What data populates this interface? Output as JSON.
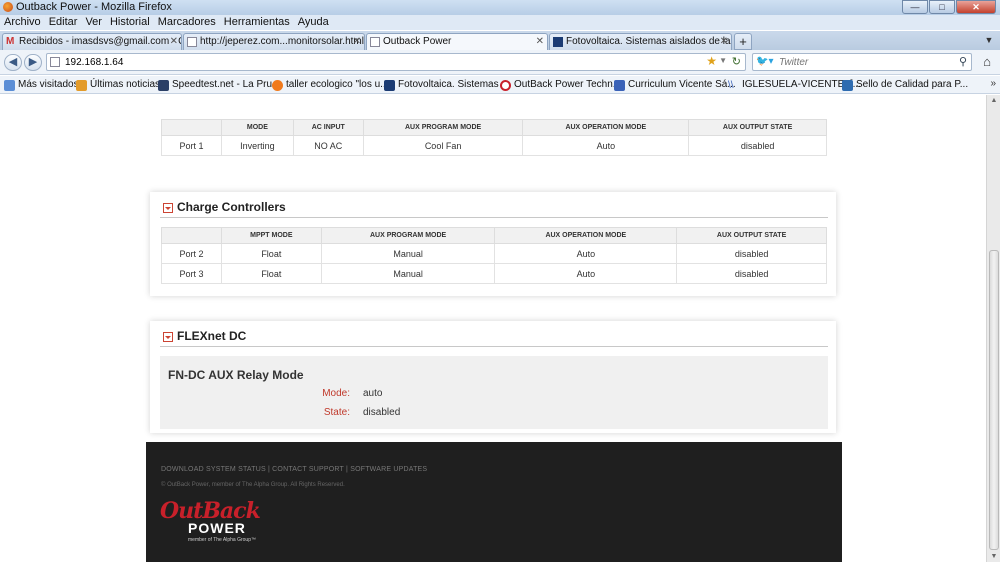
{
  "window": {
    "title": "Outback Power - Mozilla Firefox",
    "minimize": "—",
    "maximize": "□",
    "close": "✕"
  },
  "menu": [
    "Archivo",
    "Editar",
    "Ver",
    "Historial",
    "Marcadores",
    "Herramientas",
    "Ayuda"
  ],
  "tabs": [
    {
      "label": "Recibidos - imasdsvs@gmail.com - G...",
      "icon": "gmail-icon"
    },
    {
      "label": "http://jeperez.com...monitorsolar.html",
      "icon": "page-icon"
    },
    {
      "label": "Outback Power",
      "icon": "page-icon",
      "active": true
    },
    {
      "label": "Fotovoltaica. Sistemas aislados de la r...",
      "icon": "fotovoltaica-icon"
    }
  ],
  "nav": {
    "url": "192.168.1.64",
    "search_placeholder": "Twitter"
  },
  "bookmarks": [
    "Más visitados",
    "Últimas noticias",
    "Speedtest.net - La Pru...",
    "taller ecologico \"los u...",
    "Fotovoltaica. Sistemas ...",
    "OutBack Power Techn...",
    "Curriculum Vicente Sá...",
    "IGLESUELA-VICENTE: [...",
    "Sello de Calidad para P..."
  ],
  "inverters": {
    "headers": [
      "",
      "MODE",
      "AC INPUT",
      "AUX PROGRAM MODE",
      "AUX OPERATION MODE",
      "AUX OUTPUT STATE"
    ],
    "rows": [
      [
        "Port 1",
        "Inverting",
        "NO AC",
        "Cool Fan",
        "Auto",
        "disabled"
      ]
    ]
  },
  "charge_controllers": {
    "title": "Charge Controllers",
    "headers": [
      "",
      "MPPT MODE",
      "AUX PROGRAM MODE",
      "AUX OPERATION MODE",
      "AUX OUTPUT STATE"
    ],
    "rows": [
      [
        "Port 2",
        "Float",
        "Manual",
        "Auto",
        "disabled"
      ],
      [
        "Port 3",
        "Float",
        "Manual",
        "Auto",
        "disabled"
      ]
    ]
  },
  "flexnet": {
    "title": "FLEXnet DC",
    "subtitle": "FN-DC AUX Relay Mode",
    "mode_label": "Mode:",
    "mode_value": "auto",
    "state_label": "State:",
    "state_value": "disabled"
  },
  "footer": {
    "links": "DOWNLOAD SYSTEM STATUS | CONTACT SUPPORT | SOFTWARE UPDATES",
    "copyright": "© OutBack Power, member of The Alpha Group. All Rights Reserved.",
    "logo_top": "OutBack",
    "logo_bottom": "POWER",
    "logo_tag": "member of The Alpha Group™"
  }
}
